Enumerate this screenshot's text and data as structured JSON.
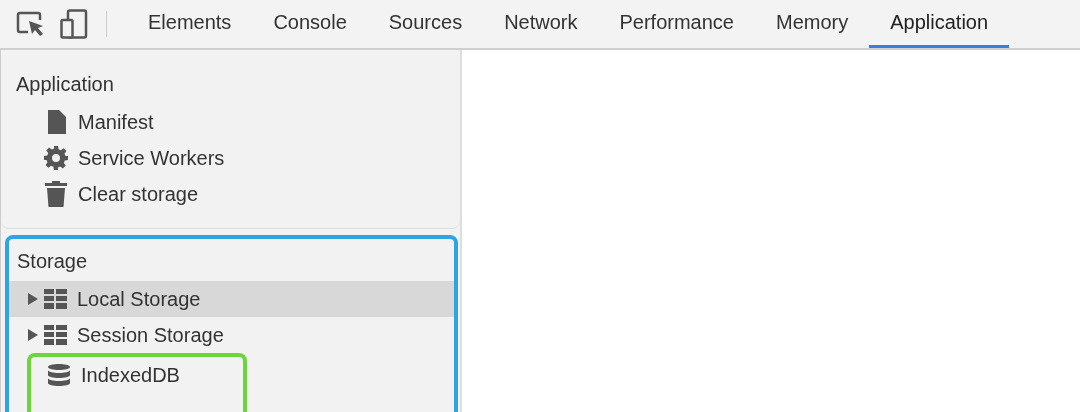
{
  "tabs": [
    {
      "label": "Elements",
      "selected": false
    },
    {
      "label": "Console",
      "selected": false
    },
    {
      "label": "Sources",
      "selected": false
    },
    {
      "label": "Network",
      "selected": false
    },
    {
      "label": "Performance",
      "selected": false
    },
    {
      "label": "Memory",
      "selected": false
    },
    {
      "label": "Application",
      "selected": true
    }
  ],
  "sidebar": {
    "sections": [
      {
        "title": "Application",
        "outlined": false,
        "items": [
          {
            "label": "Manifest",
            "kind": "file",
            "expandable": false,
            "selected": false
          },
          {
            "label": "Service Workers",
            "kind": "gear",
            "expandable": false,
            "selected": false
          },
          {
            "label": "Clear storage",
            "kind": "trash",
            "expandable": false,
            "selected": false
          }
        ]
      },
      {
        "title": "Storage",
        "outlined": true,
        "items": [
          {
            "label": "Local Storage",
            "kind": "table",
            "expandable": true,
            "selected": true
          },
          {
            "label": "Session Storage",
            "kind": "table",
            "expandable": true,
            "selected": false
          }
        ],
        "boxed_items": [
          {
            "label": "IndexedDB",
            "kind": "database",
            "expandable": false,
            "selected": false
          }
        ]
      }
    ]
  }
}
